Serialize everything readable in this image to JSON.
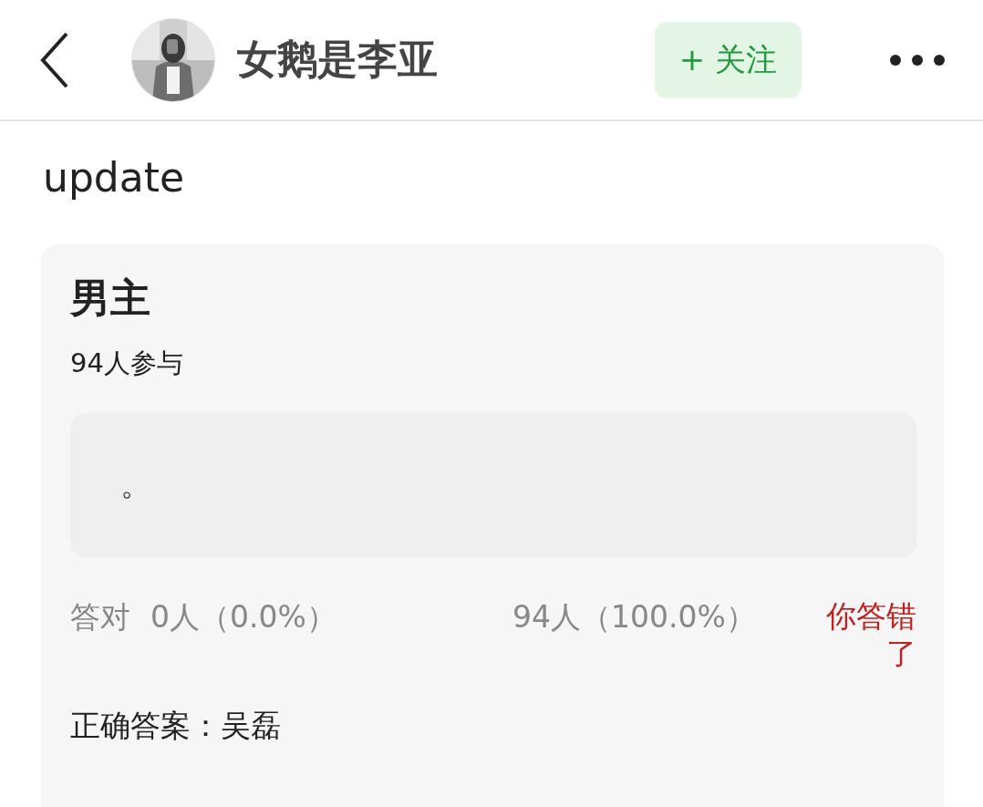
{
  "header": {
    "user": {
      "name": "女鹅是李亚"
    },
    "follow_button": "+ 关注"
  },
  "post": {
    "text": "update"
  },
  "quiz": {
    "title": "男主",
    "participants": "94人参与",
    "options": [
      {
        "text": "。",
        "selected": false
      }
    ],
    "stats": {
      "correct_label": "答对",
      "correct_count": "0人（0.0%）",
      "wrong_count": "94人（100.0%）",
      "result": "你答错了"
    },
    "answer": "正确答案：吴磊"
  }
}
